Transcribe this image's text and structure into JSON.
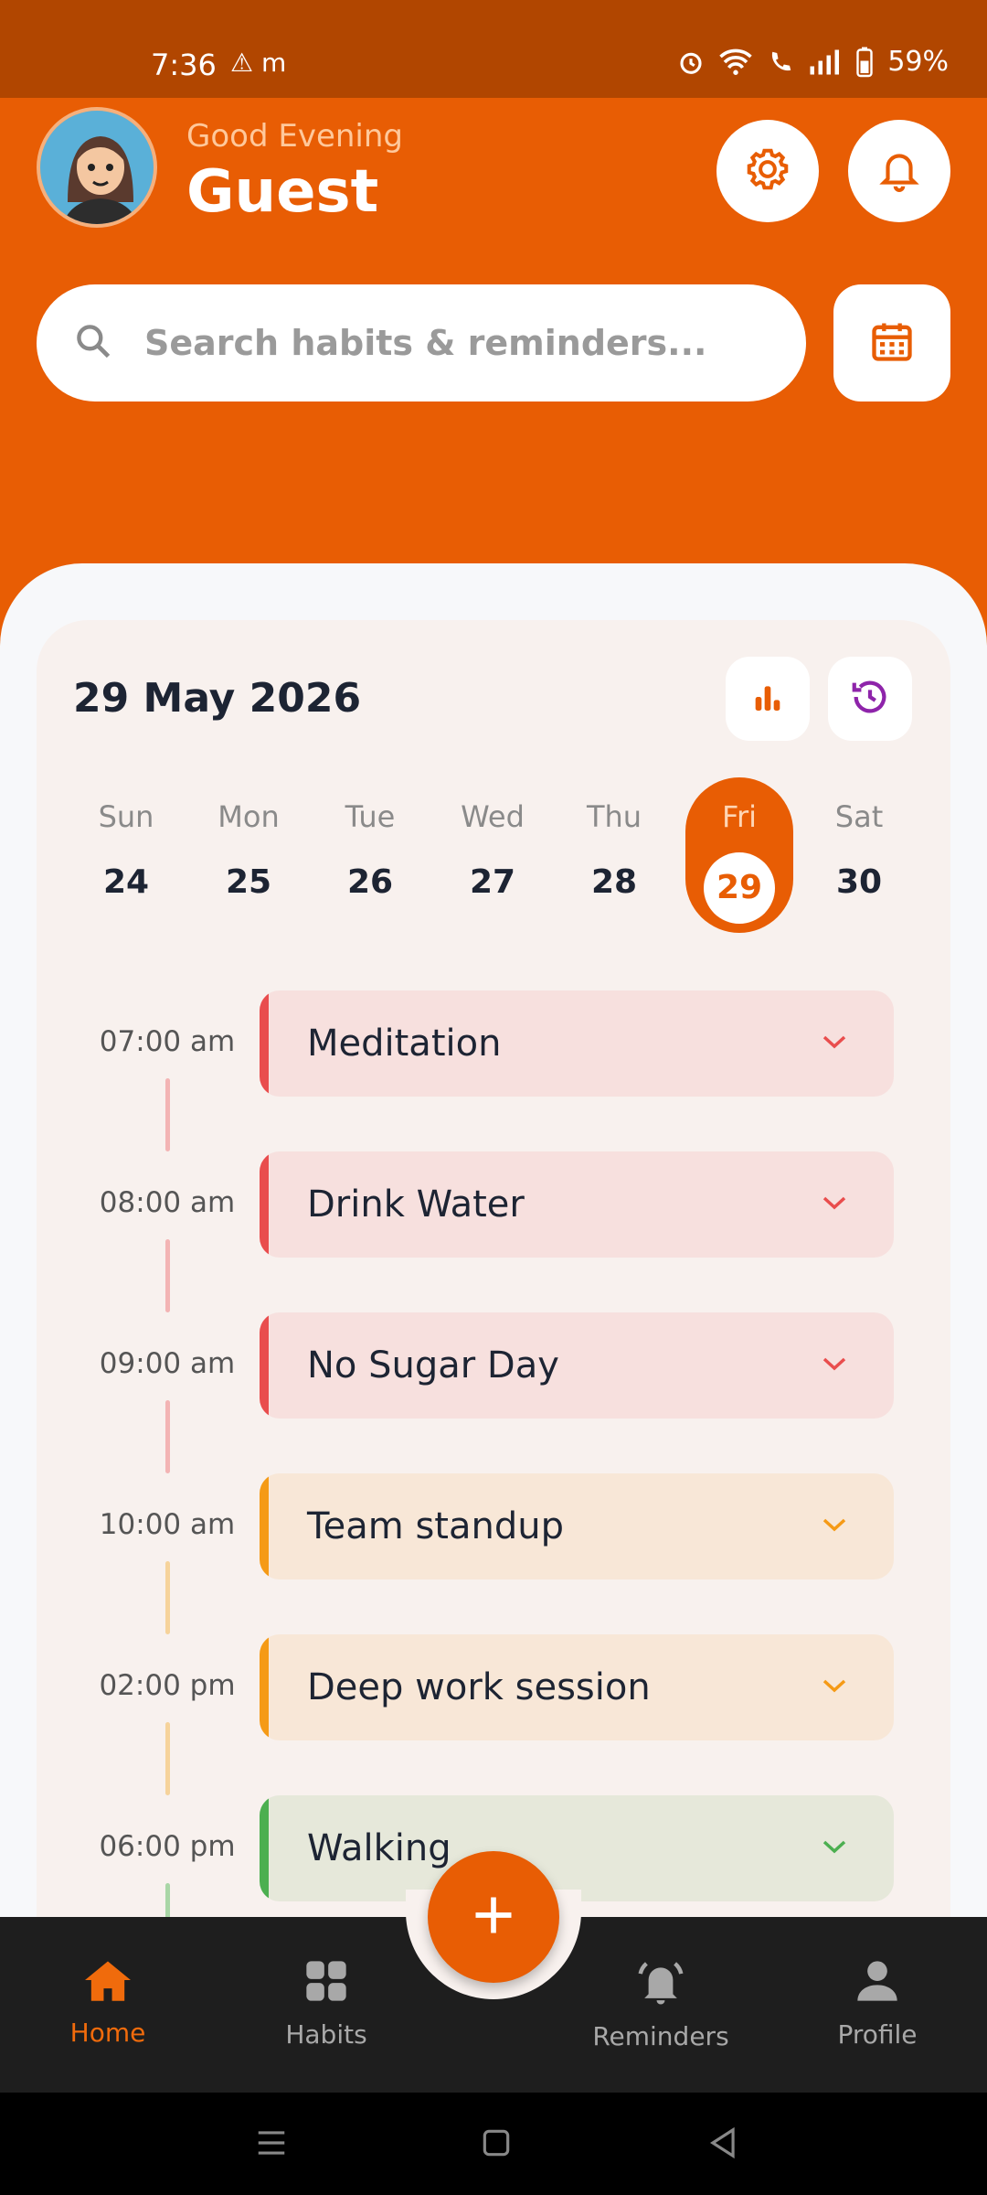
{
  "status_bar": {
    "time": "7:36",
    "left_icons": "⚠ m",
    "battery": "59%"
  },
  "header": {
    "greeting": "Good Evening",
    "name": "Guest",
    "settings_icon": "gear-icon",
    "notifications_icon": "bell-icon"
  },
  "search": {
    "placeholder": "Search habits & reminders..."
  },
  "calendar_button_icon": "calendar-icon",
  "date_header": {
    "title": "29 May 2026",
    "stats_icon": "bar-chart-icon",
    "history_icon": "history-icon"
  },
  "week": [
    {
      "day": "Sun",
      "date": "24",
      "active": false
    },
    {
      "day": "Mon",
      "date": "25",
      "active": false
    },
    {
      "day": "Tue",
      "date": "26",
      "active": false
    },
    {
      "day": "Wed",
      "date": "27",
      "active": false
    },
    {
      "day": "Thu",
      "date": "28",
      "active": false
    },
    {
      "day": "Fri",
      "date": "29",
      "active": true
    },
    {
      "day": "Sat",
      "date": "30",
      "active": false
    }
  ],
  "timeline": [
    {
      "time": "07:00 am",
      "title": "Meditation",
      "accent": "#e94d4d",
      "bg": "#f7e0de",
      "line": "#f3b4b4"
    },
    {
      "time": "08:00 am",
      "title": "Drink Water",
      "accent": "#e94d4d",
      "bg": "#f7e0de",
      "line": "#f3b4b4"
    },
    {
      "time": "09:00 am",
      "title": "No Sugar Day",
      "accent": "#e94d4d",
      "bg": "#f7e0de",
      "line": "#f3b4b4"
    },
    {
      "time": "10:00 am",
      "title": "Team standup",
      "accent": "#f59a16",
      "bg": "#f8e7d7",
      "line": "#f6d39b"
    },
    {
      "time": "02:00 pm",
      "title": "Deep work session",
      "accent": "#f59a16",
      "bg": "#f8e7d7",
      "line": "#f6d39b"
    },
    {
      "time": "06:00 pm",
      "title": "Walking",
      "accent": "#4caf50",
      "bg": "#e6e8da",
      "line": "#a9d6a6"
    }
  ],
  "bottom_nav": {
    "items": [
      {
        "label": "Home",
        "icon": "home-icon",
        "active": true
      },
      {
        "label": "Habits",
        "icon": "grid-icon",
        "active": false
      },
      {
        "label": "Reminders",
        "icon": "bell-icon",
        "active": false
      },
      {
        "label": "Profile",
        "icon": "person-icon",
        "active": false
      }
    ],
    "fab_icon": "plus-icon"
  },
  "colors": {
    "brand": "#e85d04",
    "status_bar": "#b14600"
  }
}
